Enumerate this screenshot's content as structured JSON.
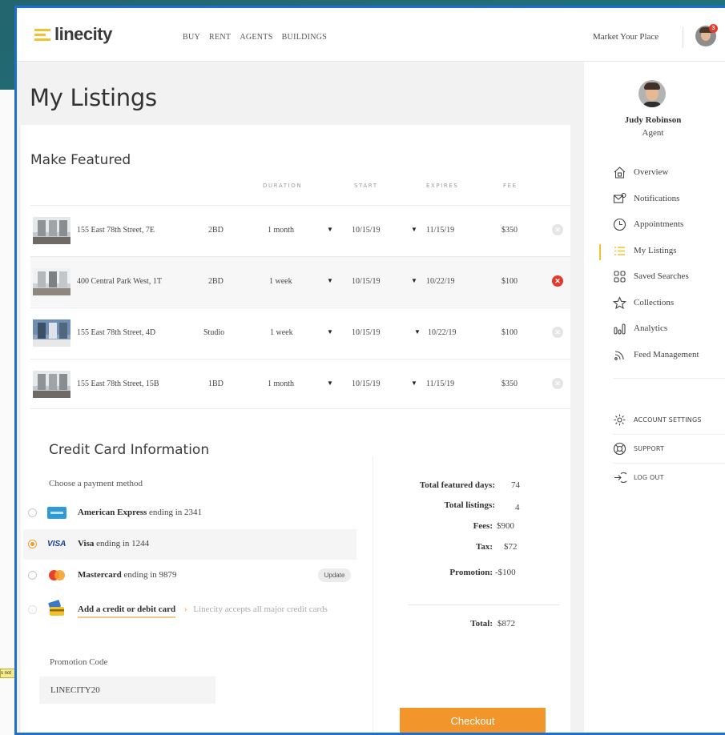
{
  "header": {
    "brand": "linecity",
    "nav": [
      "BUY",
      "RENT",
      "AGENTS",
      "BUILDINGS"
    ],
    "market_link": "Market Your Place",
    "notification_count": "3"
  },
  "page_title": "My Listings",
  "featured": {
    "title": "Make Featured",
    "columns": {
      "duration": "DURATION",
      "start": "START",
      "expires": "EXPIRES",
      "fee": "FEE"
    },
    "rows": [
      {
        "address": "155 East 78th Street, 7E",
        "beds": "2BD",
        "duration": "1 month",
        "start": "10/15/19",
        "expires": "11/15/19",
        "fee": "$350"
      },
      {
        "address": "400 Central Park West, 1T",
        "beds": "2BD",
        "duration": "1 week",
        "start": "10/15/19",
        "expires": "10/22/19",
        "fee": "$100"
      },
      {
        "address": "155 East 78th Street, 4D",
        "beds": "Studio",
        "duration": "1 week",
        "start": "10/15/19",
        "expires": "10/22/19",
        "fee": "$100"
      },
      {
        "address": "155 East 78th Street, 15B",
        "beds": "1BD",
        "duration": "1 month",
        "start": "10/15/19",
        "expires": "11/15/19",
        "fee": "$350"
      }
    ]
  },
  "credit_card": {
    "title": "Credit Card Information",
    "choose_label": "Choose a payment method",
    "methods": [
      {
        "name": "American Express",
        "suffix": "ending in 2341"
      },
      {
        "name": "Visa",
        "suffix": "ending in 1244",
        "badge": "VISA"
      },
      {
        "name": "Mastercard",
        "suffix": "ending in 9879",
        "action": "Update"
      }
    ],
    "add_card_label": "Add a credit or debit card",
    "add_card_note": "Linecity accepts all major credit cards",
    "promo_label": "Promotion Code",
    "promo_value": "LINECITY20"
  },
  "summary": {
    "total_days_label": "Total featured days:",
    "total_days": "74",
    "total_listings_label": "Total listings:",
    "total_listings": "4",
    "fees_label": "Fees:",
    "fees": "$900",
    "tax_label": "Tax:",
    "tax": "$72",
    "promotion_label": "Promotion:",
    "promotion": "-$100",
    "total_label": "Total:",
    "total": "$872",
    "checkout_label": "Checkout"
  },
  "sidebar": {
    "name": "Judy Robinson",
    "role": "Agent",
    "items": [
      "Overview",
      "Notifications",
      "Appointments",
      "My Listings",
      "Saved Searches",
      "Collections",
      "Analytics",
      "Feed Management"
    ],
    "account": [
      "ACCOUNT SETTINGS",
      "SUPPORT",
      "LOG OUT"
    ]
  },
  "colors": {
    "accent": "#f2962b",
    "brand_yellow": "#f2c12e",
    "remove_active": "#e3392c",
    "frame": "#1f6ed1",
    "background": "#1f7d85"
  },
  "icons": [
    "logo-mark-icon",
    "caret-down-icon",
    "remove-icon",
    "amex-icon",
    "visa-icon",
    "mastercard-icon",
    "add-card-icon",
    "chevron-right-icon",
    "home-icon",
    "notification-icon",
    "clock-icon",
    "list-icon",
    "grid-icon",
    "star-icon",
    "analytics-icon",
    "feed-icon",
    "gear-icon",
    "lifebuoy-icon",
    "logout-icon"
  ]
}
